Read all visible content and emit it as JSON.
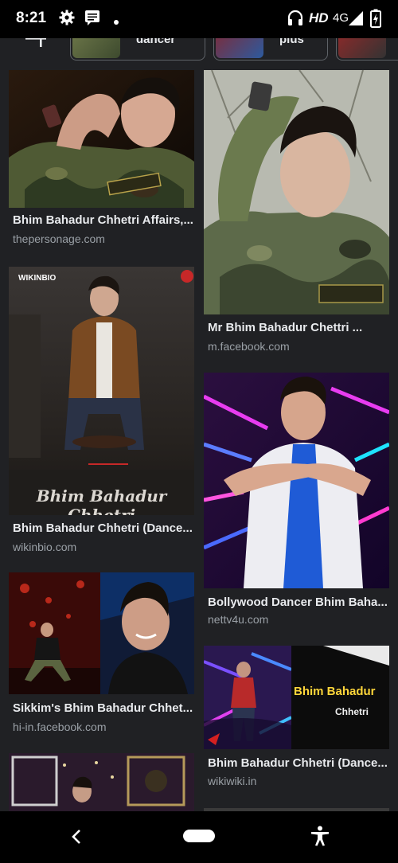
{
  "status_bar": {
    "time": "8:21",
    "hd": "HD",
    "network": "4G",
    "icons": [
      "settings-icon",
      "notification-message-icon",
      "dot-icon",
      "headphones-icon",
      "signal-icon",
      "battery-charging-icon"
    ]
  },
  "chips": [
    {
      "icon": "filter-sliders-icon"
    },
    {
      "label": "dancer"
    },
    {
      "label": "plus"
    },
    {
      "label": ""
    }
  ],
  "results": [
    {
      "title": "Bhim Bahadur Chhetri Affairs,...",
      "source": "thepersonage.com"
    },
    {
      "title": "Mr Bhim Bahadur Chettri ...",
      "source": "m.facebook.com"
    },
    {
      "title": "Bhim Bahadur Chhetri (Dance...",
      "source": "wikinbio.com",
      "overlay_logo": "WIKINBIO",
      "overlay_caption": "Bhim Bahadur Chhetri"
    },
    {
      "title": "Bollywood Dancer Bhim Baha...",
      "source": "nettv4u.com"
    },
    {
      "title": "Sikkim's Bhim Bahadur Chhet...",
      "source": "hi-in.facebook.com"
    },
    {
      "title": "Bhim Bahadur Chhetri (Dance...",
      "source": "wikiwiki.in",
      "overlay_line1": "Bhim Bahadur",
      "overlay_line2": "Chhetri"
    }
  ],
  "nav_bar": {
    "icons": [
      "back-icon",
      "home-pill-icon",
      "accessibility-icon"
    ]
  }
}
